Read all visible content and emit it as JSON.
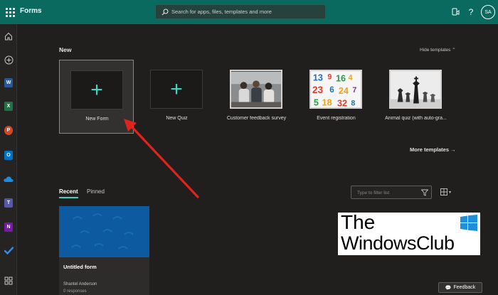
{
  "app": {
    "title": "Forms"
  },
  "search": {
    "placeholder": "Search for apps, files, templates and more"
  },
  "user": {
    "initials": "SA"
  },
  "colors": {
    "header": "#0b6a5f",
    "accent": "#3fd3c3",
    "background": "#201f1e",
    "cover": "#0e5aa0"
  },
  "rail": [
    {
      "name": "home-icon"
    },
    {
      "name": "create-icon"
    },
    {
      "name": "word-icon",
      "letter": "W",
      "color": "#2b5797"
    },
    {
      "name": "excel-icon",
      "letter": "X",
      "color": "#217346"
    },
    {
      "name": "powerpoint-icon",
      "letter": "P",
      "color": "#d24726"
    },
    {
      "name": "outlook-icon",
      "letter": "O",
      "color": "#0072c6"
    },
    {
      "name": "onedrive-icon"
    },
    {
      "name": "teams-icon",
      "letter": "T",
      "color": "#5558af"
    },
    {
      "name": "onenote-icon",
      "letter": "N",
      "color": "#7719aa"
    },
    {
      "name": "todo-icon"
    },
    {
      "name": "all-apps-icon"
    }
  ],
  "new_section": {
    "heading": "New",
    "hide_templates": "Hide templates",
    "templates": [
      {
        "label": "New Form"
      },
      {
        "label": "New Quiz"
      },
      {
        "label": "Customer feedback survey"
      },
      {
        "label": "Event registration"
      },
      {
        "label": "Animal quiz (with auto-gra..."
      }
    ],
    "more_templates": "More templates"
  },
  "list": {
    "tabs": [
      {
        "label": "Recent"
      },
      {
        "label": "Pinned"
      }
    ],
    "filter_placeholder": "Type to filter list"
  },
  "recent": [
    {
      "title": "Untitled form",
      "owner": "Shantel Anderson",
      "responses": "0 responses"
    }
  ],
  "watermark": {
    "line1": "The",
    "line2": "WindowsClub"
  },
  "feedback": {
    "label": "Feedback"
  }
}
